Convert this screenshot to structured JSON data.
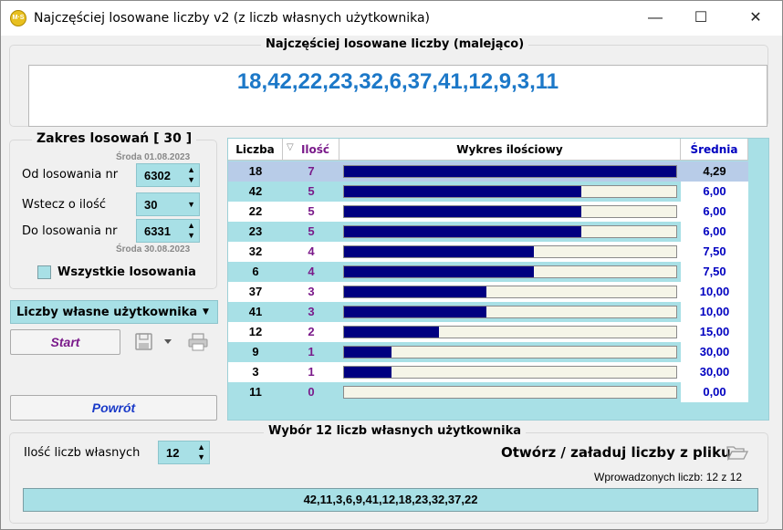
{
  "window": {
    "title": "Najczęściej losowane liczby v2 (z liczb własnych użytkownika)",
    "icon_text": "M·S",
    "minimize_glyph": "—",
    "maximize_glyph": "☐",
    "close_glyph": "✕"
  },
  "top": {
    "group_title": "Najczęściej losowane liczby (malejąco)",
    "numbers": "18,42,22,23,32,6,37,41,12,9,3,11"
  },
  "range": {
    "group_title": "Zakres losowań  [ 30 ]",
    "from_date": "Środa 01.08.2023",
    "from_label": "Od losowania nr",
    "from_value": "6302",
    "back_label": "Wstecz o ilość",
    "back_value": "30",
    "to_label": "Do losowania nr",
    "to_value": "6331",
    "to_date": "Środa 30.08.2023",
    "all_label": "Wszystkie losowania"
  },
  "controls": {
    "source_combo": "Liczby własne użytkownika",
    "start_label": "Start",
    "back_label": "Powrót"
  },
  "table": {
    "headers": {
      "number": "Liczba",
      "count": "Ilość",
      "chart": "Wykres ilościowy",
      "average": "Średnia"
    },
    "colors": {
      "count": "#7a1a8a",
      "average": "#0000c0",
      "bar": "#000080"
    },
    "max_count": 7,
    "rows": [
      {
        "number": "18",
        "count": "7",
        "average": "4,29"
      },
      {
        "number": "42",
        "count": "5",
        "average": "6,00"
      },
      {
        "number": "22",
        "count": "5",
        "average": "6,00"
      },
      {
        "number": "23",
        "count": "5",
        "average": "6,00"
      },
      {
        "number": "32",
        "count": "4",
        "average": "7,50"
      },
      {
        "number": "6",
        "count": "4",
        "average": "7,50"
      },
      {
        "number": "37",
        "count": "3",
        "average": "10,00"
      },
      {
        "number": "41",
        "count": "3",
        "average": "10,00"
      },
      {
        "number": "12",
        "count": "2",
        "average": "15,00"
      },
      {
        "number": "9",
        "count": "1",
        "average": "30,00"
      },
      {
        "number": "3",
        "count": "1",
        "average": "30,00"
      },
      {
        "number": "11",
        "count": "0",
        "average": "0,00"
      }
    ]
  },
  "user_numbers": {
    "group_title": "Wybór 12 liczb własnych użytkownika",
    "count_label": "Ilość liczb własnych",
    "count_value": "12",
    "open_label": "Otwórz / załaduj liczby z pliku",
    "entered_label": "Wprowadzonych liczb: 12 z 12",
    "numbers": "42,11,3,6,9,41,12,18,23,32,37,22"
  }
}
